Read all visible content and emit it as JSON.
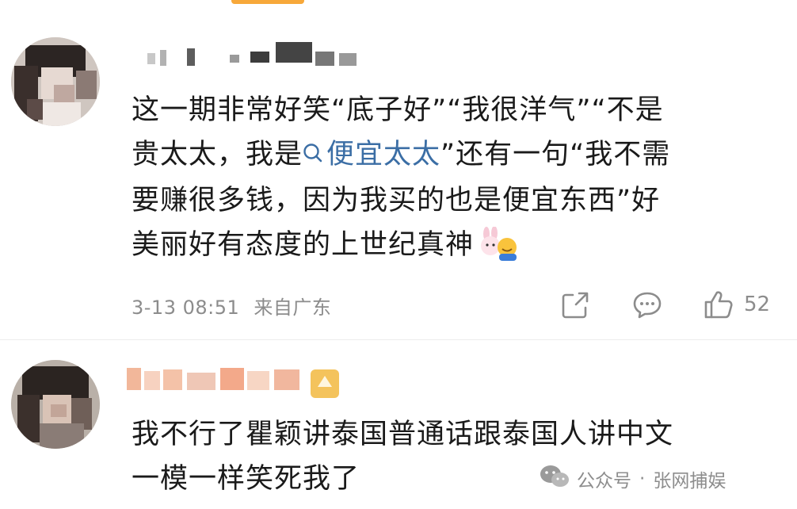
{
  "comments": [
    {
      "lines": [
        {
          "text": "这一期非常好笑“底子好”“我很洋气”“不是"
        },
        {
          "pre": "贵太太，我是",
          "link": "便宜太太",
          "post": "”还有一句“我不需"
        },
        {
          "text": "要赚很多钱，因为我买的也是便宜东西”好"
        },
        {
          "text": "美丽好有态度的上世纪真神"
        }
      ],
      "time": "3-13 08:51",
      "source": "来自广东",
      "like_count": "52"
    },
    {
      "lines": [
        {
          "text": "我不行了瞿颖讲泰国普通话跟泰国人讲中文"
        },
        {
          "text": "一模一样笑死我了"
        }
      ]
    }
  ],
  "watermark": {
    "account_type": "公众号",
    "dot": "·",
    "account_name": "张网捕娱"
  },
  "icons": {
    "share": "share-icon",
    "comment": "comment-icon",
    "like": "thumbs-up-icon",
    "emoji": "bunny-hug-emoji-icon",
    "badge": "level-badge-icon",
    "watermark": "wechat-logo-icon"
  },
  "colors": {
    "link": "#3b6ea5",
    "meta": "#8c8c8c",
    "accent": "#f7a83a"
  }
}
